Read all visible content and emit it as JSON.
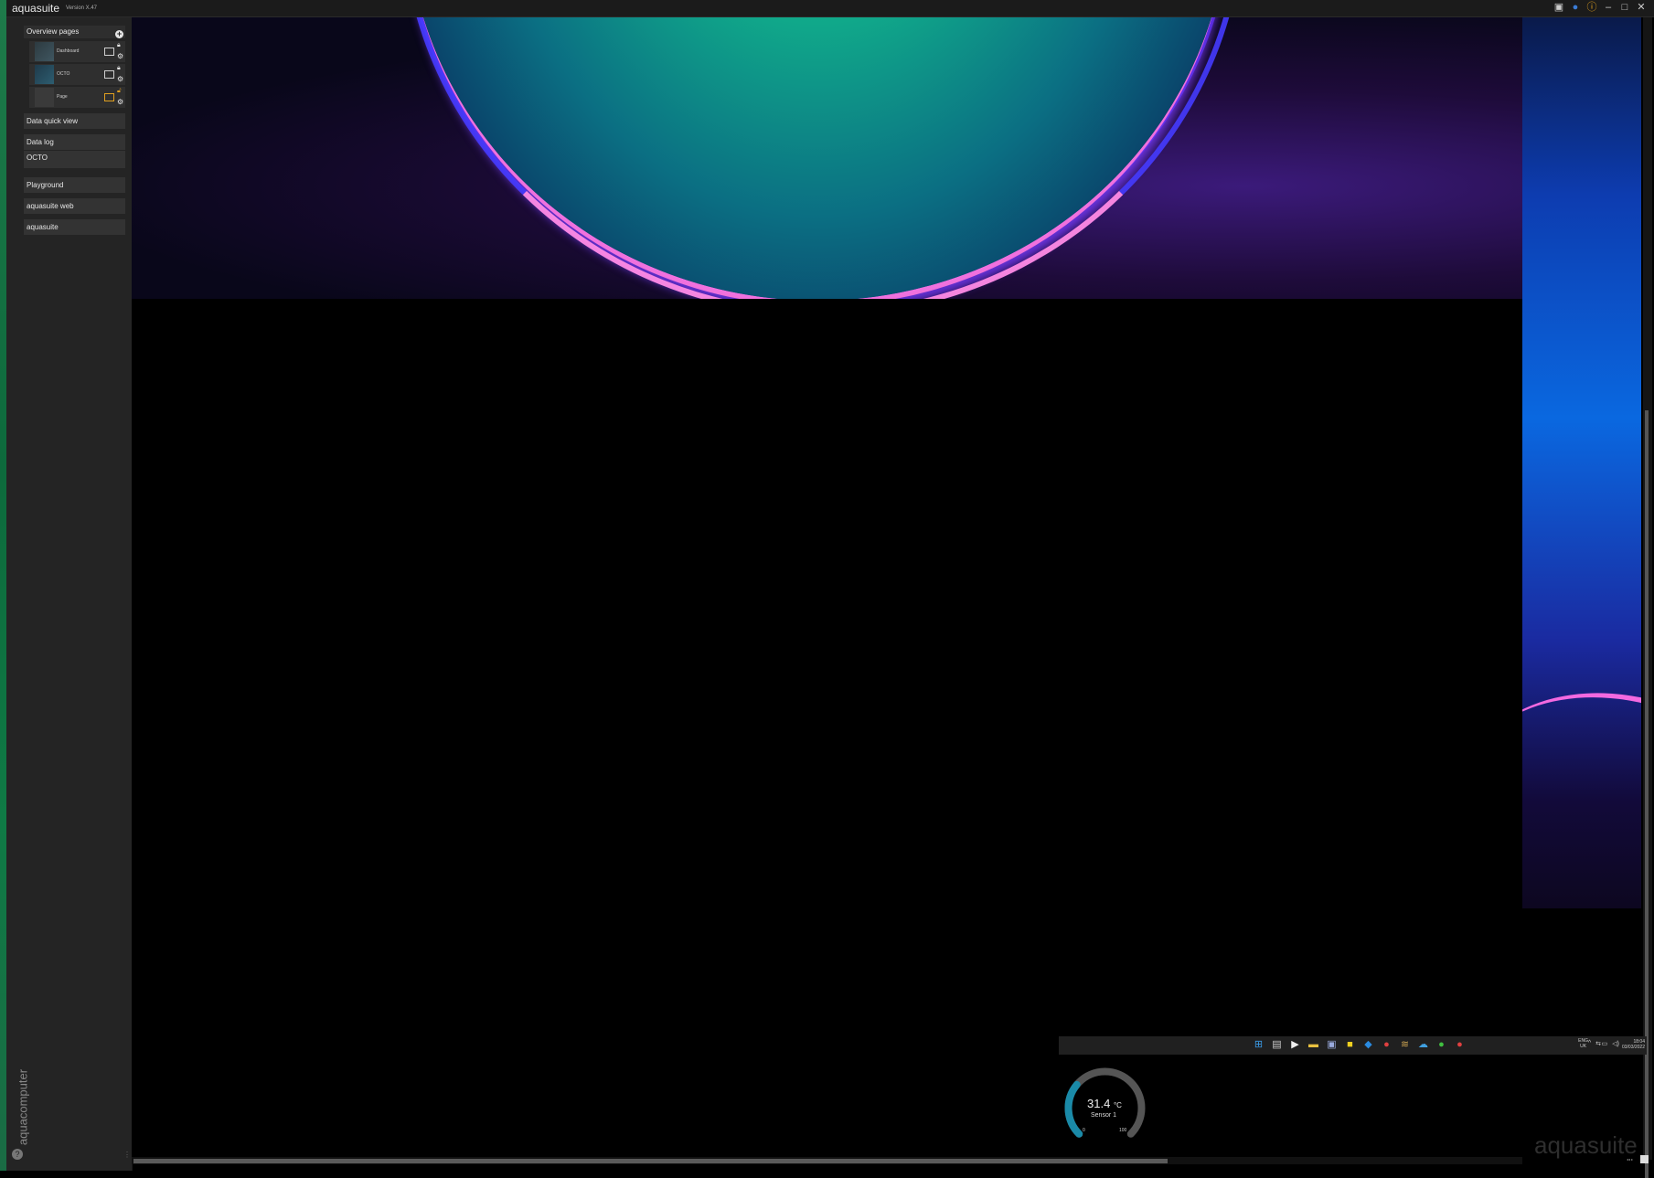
{
  "app": {
    "title": "aquasuite",
    "version": "Version X.47"
  },
  "sidebar": {
    "overview_label": "Overview pages",
    "pages": [
      {
        "label": "Dashboard",
        "locked": true
      },
      {
        "label": "OCTO",
        "locked": true
      },
      {
        "label": "Page",
        "locked": false
      }
    ],
    "items": [
      {
        "label": "Data quick view"
      },
      {
        "label": "Data log"
      },
      {
        "label": "OCTO"
      },
      {
        "label": "Playground"
      },
      {
        "label": "aquasuite web"
      },
      {
        "label": "aquasuite"
      }
    ],
    "brand": "aquacomputer"
  },
  "taskbar": {
    "lang_top": "ENG",
    "lang_bottom": "UK",
    "time": "18:04",
    "date": "03/03/2022"
  },
  "gauge": {
    "value": "31.4",
    "unit": "°C",
    "label": "Sensor 1",
    "min": "0",
    "max": "100",
    "fraction": 0.314,
    "track_color": "#555555",
    "fill_color": "#1a8aa8"
  },
  "watermark": "aquasuite",
  "colors": {
    "accent_green": "#0d6a3c",
    "sidebar_bg": "#242424",
    "warning_orange": "#e0a020"
  }
}
